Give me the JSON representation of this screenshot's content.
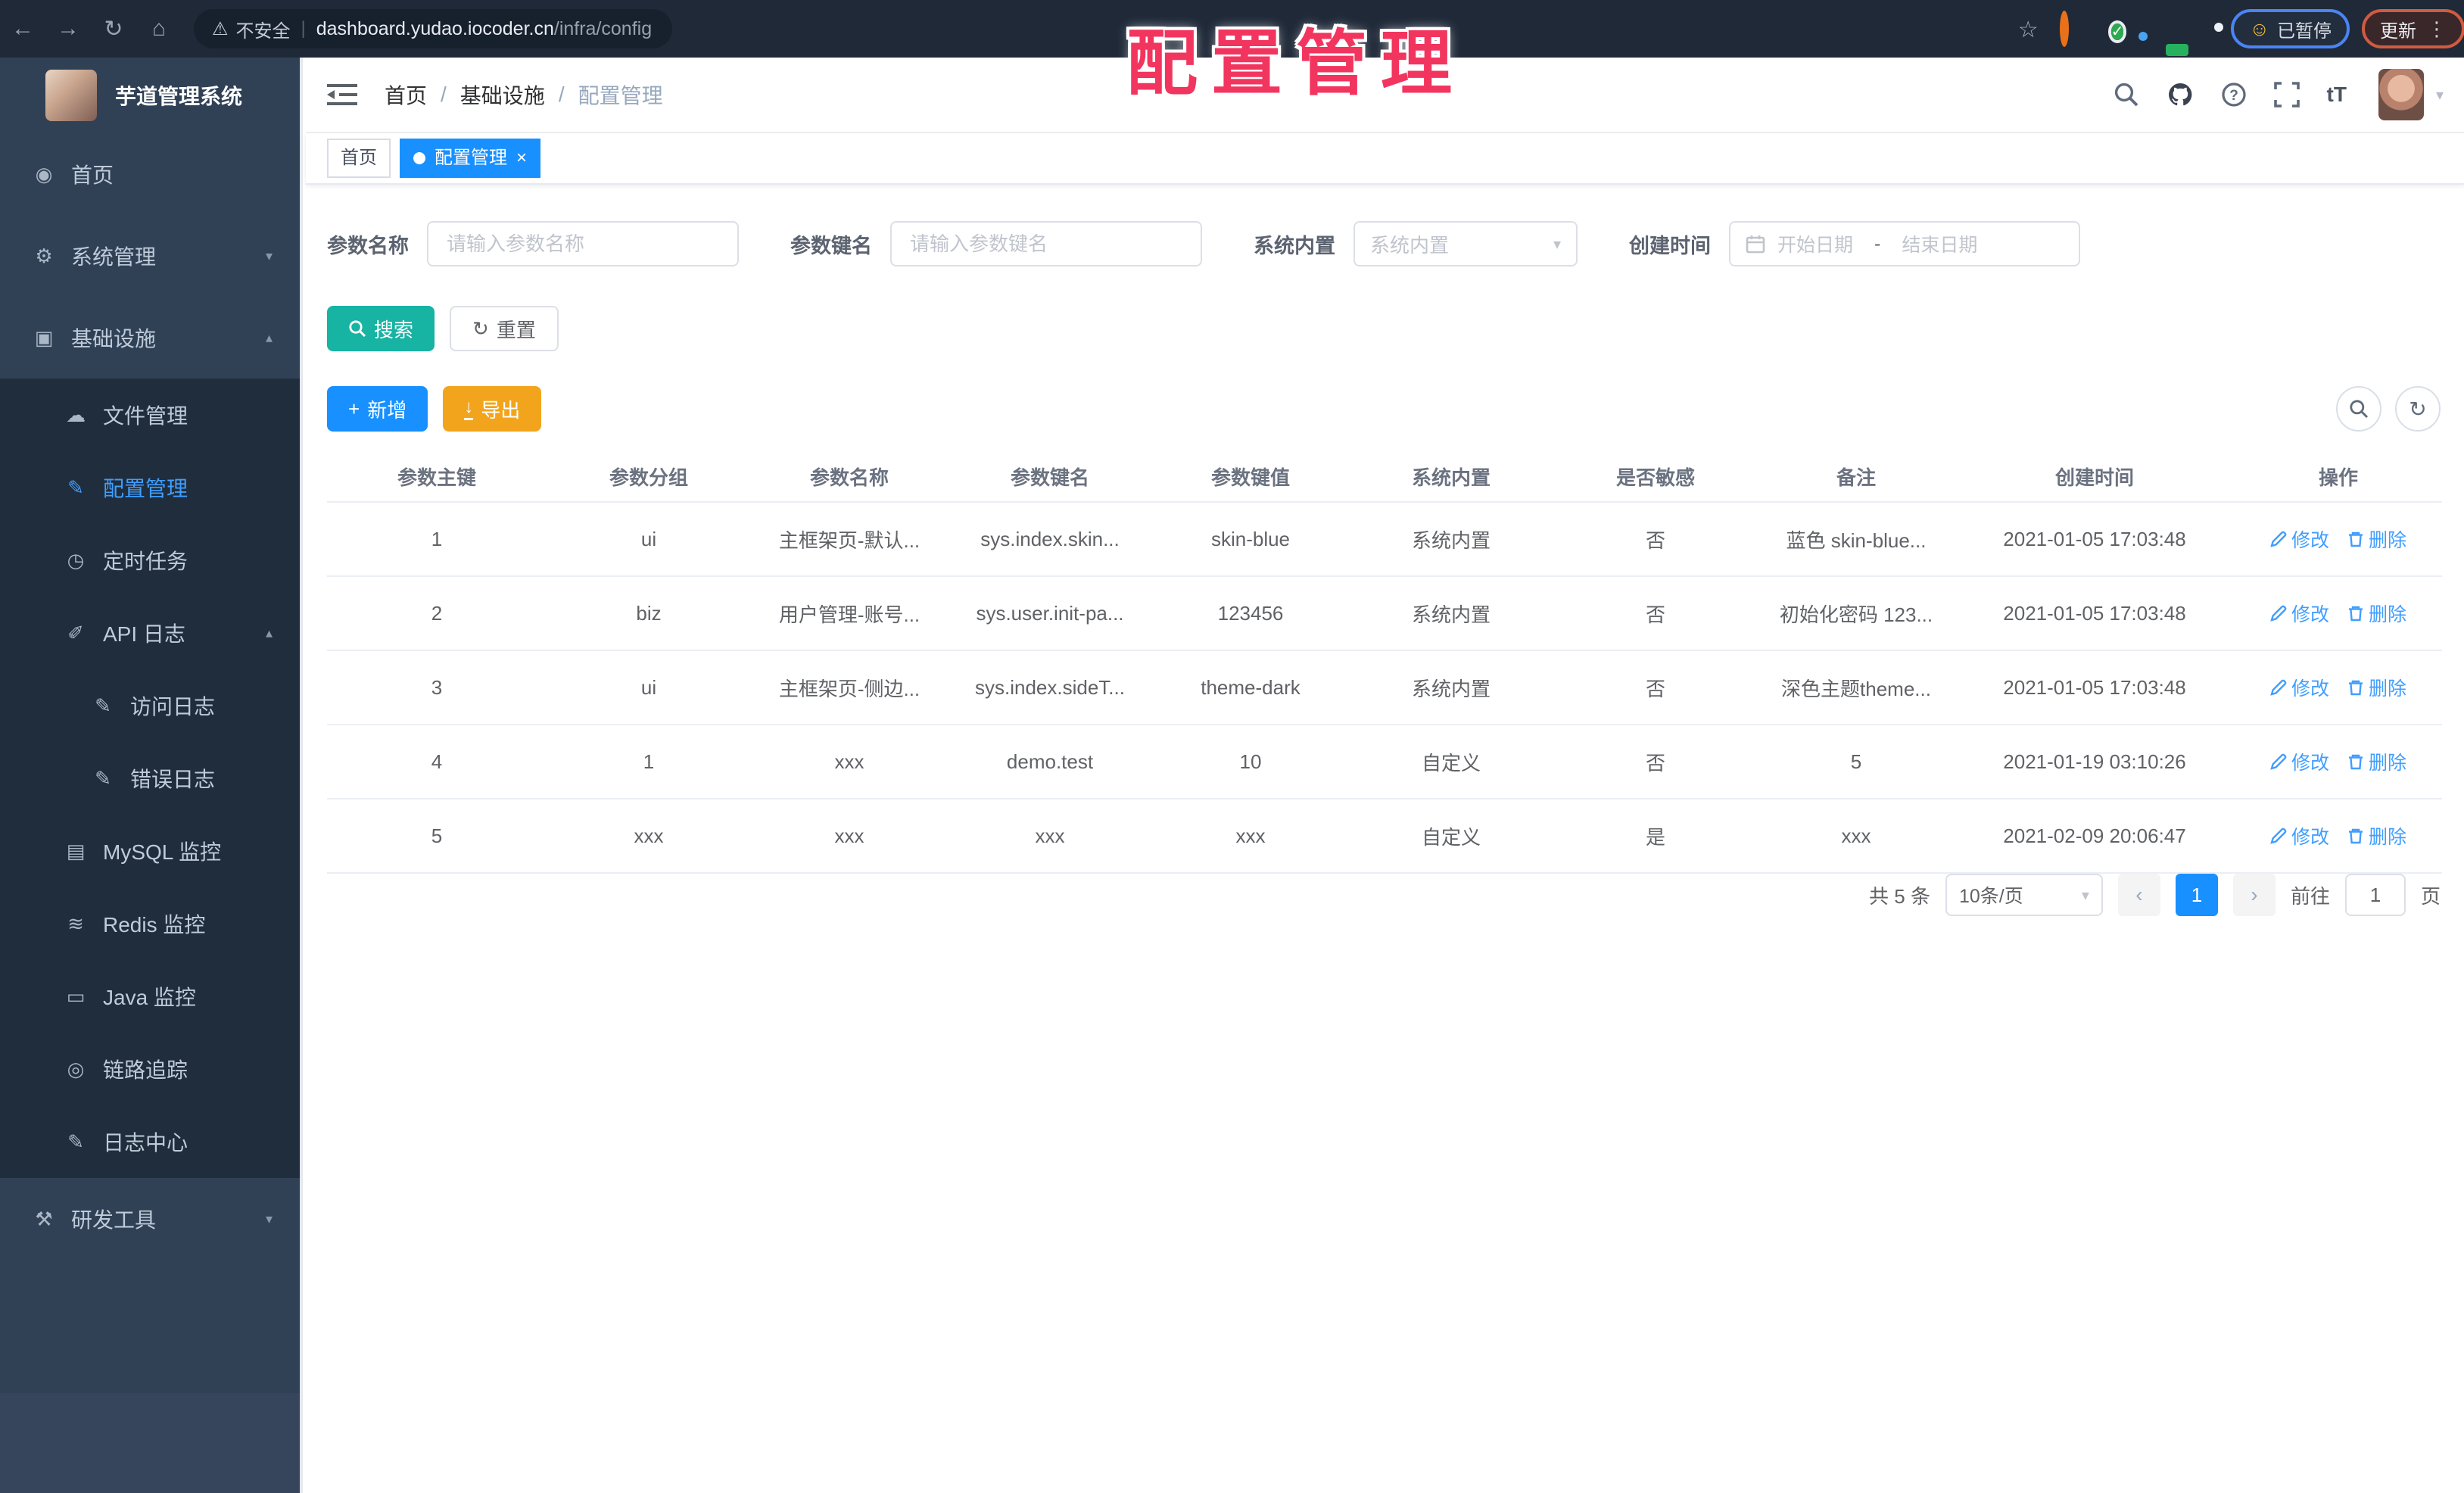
{
  "accent": {
    "solid_blue": "#1890ff",
    "link_blue": "#409eff",
    "teal": "#17b3a3",
    "orange": "#f2a51c",
    "overlay_red": "#f2355f"
  },
  "icons": {
    "back": "←",
    "forward": "→",
    "reload": "↻",
    "home": "⌂",
    "warning": "⚠",
    "divider": "|",
    "star": "☆",
    "check": "✓",
    "smiley": "☺",
    "kebab": "⋮",
    "caret_down": "▾",
    "chevron_down": "▾",
    "chevron_up": "▴",
    "close": "×",
    "plus": "+",
    "refresh": "↻",
    "down_arrow": "↓",
    "question": "?",
    "font_size": "tT",
    "select_caret": "▾",
    "dashboard-icon": "◉",
    "gear-icon": "⚙",
    "monitor-icon": "▣",
    "cloud-upload-icon": "☁",
    "edit-square-icon": "✎",
    "clock-icon": "◷",
    "log-edit-icon": "✐",
    "edit-doc-icon": "✎",
    "database-icon": "▤",
    "redis-icon": "≋",
    "java-monitor-icon": "▭",
    "eye-icon": "◎",
    "log-center-icon": "✎",
    "toolbox-icon": "⚒"
  },
  "browser": {
    "secure_warning": "不安全",
    "url_host": "dashboard.yudao.iocoder.cn",
    "url_path": "/infra/config",
    "paused_badge": "已暂停",
    "update_button": "更新"
  },
  "overlay_title": "配置管理",
  "sidebar": {
    "title": "芋道管理系统",
    "items": [
      {
        "name": "home",
        "label": "首页",
        "icon": "dashboard-icon",
        "level": 0
      },
      {
        "name": "system-management",
        "label": "系统管理",
        "icon": "gear-icon",
        "level": 0,
        "chevron": "down"
      },
      {
        "name": "infrastructure",
        "label": "基础设施",
        "icon": "monitor-icon",
        "level": 0,
        "chevron": "up"
      },
      {
        "name": "file-management",
        "label": "文件管理",
        "icon": "cloud-upload-icon",
        "level": 1,
        "sub": true
      },
      {
        "name": "config-management",
        "label": "配置管理",
        "icon": "edit-square-icon",
        "level": 1,
        "sub": true,
        "active": true
      },
      {
        "name": "scheduled-tasks",
        "label": "定时任务",
        "icon": "clock-icon",
        "level": 1,
        "sub": true
      },
      {
        "name": "api-logs",
        "label": "API 日志",
        "icon": "log-edit-icon",
        "level": 1,
        "sub": true,
        "chevron": "up"
      },
      {
        "name": "access-logs",
        "label": "访问日志",
        "icon": "edit-doc-icon",
        "level": 2,
        "sub": true
      },
      {
        "name": "error-logs",
        "label": "错误日志",
        "icon": "edit-doc-icon",
        "level": 2,
        "sub": true
      },
      {
        "name": "mysql-monitor",
        "label": "MySQL 监控",
        "icon": "database-icon",
        "level": 1,
        "sub": true
      },
      {
        "name": "redis-monitor",
        "label": "Redis 监控",
        "icon": "redis-icon",
        "level": 1,
        "sub": true
      },
      {
        "name": "java-monitor",
        "label": "Java 监控",
        "icon": "java-monitor-icon",
        "level": 1,
        "sub": true
      },
      {
        "name": "tracing",
        "label": "链路追踪",
        "icon": "eye-icon",
        "level": 1,
        "sub": true
      },
      {
        "name": "log-center",
        "label": "日志中心",
        "icon": "log-center-icon",
        "level": 1,
        "sub": true
      },
      {
        "name": "dev-tools",
        "label": "研发工具",
        "icon": "toolbox-icon",
        "level": 0,
        "chevron": "down"
      }
    ]
  },
  "header": {
    "breadcrumb": [
      "首页",
      "基础设施",
      "配置管理"
    ],
    "separator": "/"
  },
  "tags": [
    {
      "label": "首页",
      "active": false
    },
    {
      "label": "配置管理",
      "active": true
    }
  ],
  "filters": {
    "name_label": "参数名称",
    "name_placeholder": "请输入参数名称",
    "key_label": "参数键名",
    "key_placeholder": "请输入参数键名",
    "type_label": "系统内置",
    "type_placeholder": "系统内置",
    "date_label": "创建时间",
    "date_start_placeholder": "开始日期",
    "date_separator": "-",
    "date_end_placeholder": "结束日期"
  },
  "toolbar": {
    "search": "搜索",
    "reset": "重置",
    "add": "新增",
    "export": "导出"
  },
  "table": {
    "headers": [
      "参数主键",
      "参数分组",
      "参数名称",
      "参数键名",
      "参数键值",
      "系统内置",
      "是否敏感",
      "备注",
      "创建时间",
      "操作"
    ],
    "rows": [
      {
        "cells": [
          "1",
          "ui",
          "主框架页-默认...",
          "sys.index.skin...",
          "skin-blue",
          "系统内置",
          "否",
          "蓝色 skin-blue...",
          "2021-01-05 17:03:48"
        ]
      },
      {
        "cells": [
          "2",
          "biz",
          "用户管理-账号...",
          "sys.user.init-pa...",
          "123456",
          "系统内置",
          "否",
          "初始化密码 123...",
          "2021-01-05 17:03:48"
        ]
      },
      {
        "cells": [
          "3",
          "ui",
          "主框架页-侧边...",
          "sys.index.sideT...",
          "theme-dark",
          "系统内置",
          "否",
          "深色主题theme...",
          "2021-01-05 17:03:48"
        ]
      },
      {
        "cells": [
          "4",
          "1",
          "xxx",
          "demo.test",
          "10",
          "自定义",
          "否",
          "5",
          "2021-01-19 03:10:26"
        ]
      },
      {
        "cells": [
          "5",
          "xxx",
          "xxx",
          "xxx",
          "xxx",
          "自定义",
          "是",
          "xxx",
          "2021-02-09 20:06:47"
        ]
      }
    ],
    "row_actions": {
      "edit": "修改",
      "delete": "删除"
    }
  },
  "pagination": {
    "total": "共 5 条",
    "page_size": "10条/页",
    "prev": "‹",
    "current": "1",
    "next": "›",
    "goto_label": "前往",
    "goto_value": "1",
    "page_label": "页"
  }
}
